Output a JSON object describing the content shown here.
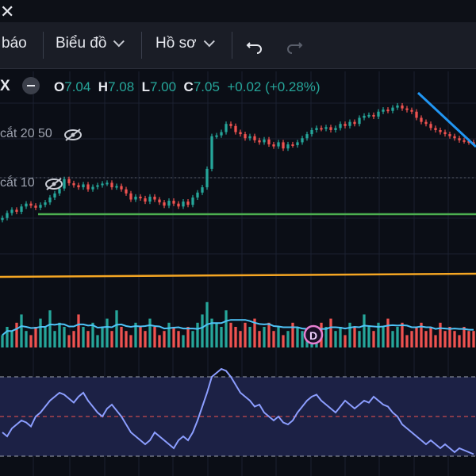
{
  "toolbar": {
    "item_partial": "báo",
    "chart_menu": "Biểu đồ",
    "profile_menu": "Hồ sơ"
  },
  "symbol_partial": "X",
  "ohlc": {
    "open_label": "O",
    "open": "7.04",
    "high_label": "H",
    "high": "7.08",
    "low_label": "L",
    "low": "7.00",
    "close_label": "C",
    "close": "7.05",
    "change": "+0.02",
    "change_pct": "(+0.28%)"
  },
  "indicators": {
    "ma_20_50": "cắt 20 50",
    "ma_10": "cắt 10"
  },
  "volume_marker": "D",
  "colors": {
    "up": "#26a69a",
    "down": "#ef5350",
    "ma_green": "#4caf50",
    "ma_orange": "#f5a623",
    "trendline": "#2196f3",
    "rsi": "#8c9eff",
    "rsi_band_fill": "#1c2145",
    "volume_ma": "#4fc3f7"
  },
  "icons": [
    "close-icon",
    "chevron-down-icon",
    "undo-icon",
    "redo-icon",
    "minus-icon",
    "eye-off-icon"
  ],
  "chart_data": [
    {
      "type": "candlestick",
      "title": "",
      "xlabel": "",
      "ylabel": "",
      "x": [
        1,
        2,
        3,
        4,
        5,
        6,
        7,
        8,
        9,
        10,
        11,
        12,
        13,
        14,
        15,
        16,
        17,
        18,
        19,
        20,
        21,
        22,
        23,
        24,
        25,
        26,
        27,
        28,
        29,
        30,
        31,
        32,
        33,
        34,
        35,
        36,
        37,
        38,
        39,
        40,
        41,
        42,
        43,
        44,
        45,
        46,
        47,
        48,
        49,
        50,
        51,
        52,
        53,
        54,
        55,
        56,
        57,
        58,
        59,
        60,
        61,
        62,
        63,
        64,
        65,
        66,
        67,
        68,
        69,
        70,
        71,
        72,
        73,
        74,
        75,
        76,
        77,
        78,
        79,
        80,
        81,
        82,
        83,
        84,
        85,
        86,
        87,
        88,
        89,
        90,
        91,
        92,
        93,
        94,
        95,
        96,
        97,
        98,
        99,
        100
      ],
      "close": [
        4.1,
        4.22,
        4.3,
        4.25,
        4.38,
        4.45,
        4.4,
        4.35,
        4.42,
        4.48,
        4.6,
        4.7,
        4.82,
        5.05,
        4.95,
        4.9,
        4.85,
        4.92,
        4.8,
        4.86,
        4.9,
        4.94,
        4.96,
        4.85,
        4.88,
        4.8,
        4.7,
        4.55,
        4.62,
        4.58,
        4.5,
        4.62,
        4.55,
        4.48,
        4.4,
        4.52,
        4.45,
        4.38,
        4.5,
        4.42,
        4.6,
        4.72,
        4.85,
        5.3,
        6.1,
        6.12,
        6.2,
        6.4,
        6.35,
        6.2,
        6.15,
        6.05,
        6.1,
        6.0,
        5.95,
        6.02,
        5.9,
        5.85,
        5.95,
        5.8,
        5.9,
        5.88,
        5.95,
        6.05,
        6.15,
        6.25,
        6.3,
        6.28,
        6.32,
        6.25,
        6.3,
        6.4,
        6.35,
        6.45,
        6.4,
        6.55,
        6.6,
        6.62,
        6.58,
        6.7,
        6.75,
        6.72,
        6.8,
        6.85,
        6.78,
        6.74,
        6.7,
        6.55,
        6.45,
        6.4,
        6.3,
        6.25,
        6.2,
        6.15,
        6.1,
        6.05,
        6.0,
        5.98,
        5.95,
        5.92
      ],
      "annotations": [
        "trendline"
      ]
    },
    {
      "type": "bar",
      "title": "",
      "values": [
        3,
        5,
        4,
        6,
        8,
        4,
        3,
        5,
        7,
        5,
        9,
        4,
        6,
        5,
        3,
        4,
        8,
        5,
        4,
        6,
        3,
        5,
        7,
        4,
        9,
        5,
        4,
        3,
        6,
        5,
        4,
        7,
        5,
        3,
        4,
        6,
        5,
        4,
        3,
        5,
        4,
        6,
        8,
        11,
        7,
        6,
        5,
        9,
        6,
        5,
        4,
        6,
        5,
        7,
        4,
        5,
        6,
        4,
        5,
        3,
        4,
        6,
        5,
        4,
        3,
        5,
        4,
        6,
        5,
        7,
        4,
        5,
        3,
        6,
        5,
        4,
        8,
        5,
        4,
        6,
        5,
        7,
        4,
        5,
        6,
        3,
        4,
        5,
        6,
        4,
        5,
        3,
        6,
        4,
        5,
        4,
        3,
        5,
        4,
        4
      ]
    },
    {
      "type": "line",
      "title": "",
      "values": [
        42,
        40,
        44,
        46,
        48,
        47,
        45,
        50,
        52,
        55,
        58,
        60,
        62,
        61,
        59,
        57,
        60,
        62,
        58,
        55,
        52,
        50,
        54,
        56,
        53,
        50,
        46,
        42,
        40,
        38,
        36,
        38,
        42,
        40,
        38,
        36,
        34,
        38,
        40,
        38,
        42,
        48,
        55,
        62,
        70,
        72,
        74,
        73,
        70,
        66,
        62,
        60,
        58,
        55,
        56,
        52,
        50,
        48,
        50,
        47,
        46,
        48,
        52,
        55,
        58,
        60,
        61,
        58,
        56,
        54,
        52,
        55,
        58,
        56,
        54,
        56,
        58,
        57,
        60,
        58,
        56,
        55,
        52,
        50,
        46,
        44,
        42,
        40,
        38,
        36,
        38,
        36,
        34,
        36,
        34,
        32,
        34,
        33,
        32,
        31
      ],
      "ylim": [
        20,
        80
      ]
    }
  ]
}
